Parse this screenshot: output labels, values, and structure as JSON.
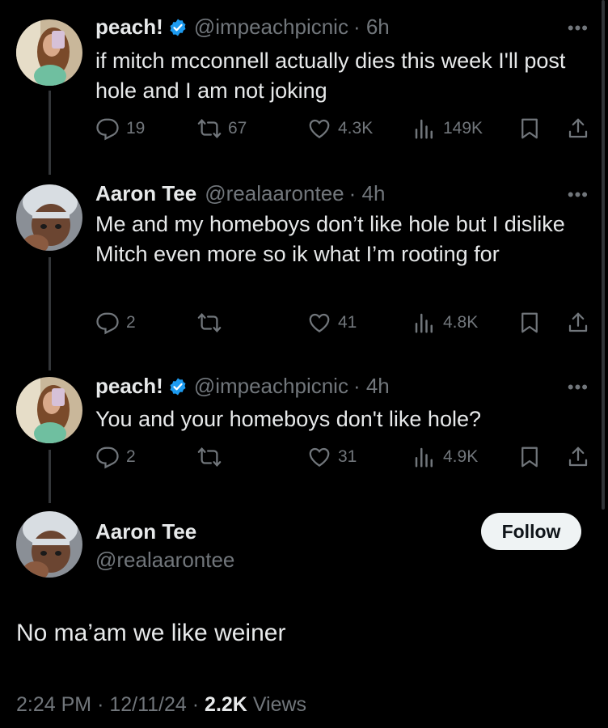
{
  "tweets": [
    {
      "name": "peach!",
      "handle": "@impeachpicnic",
      "time": "· 6h",
      "text": "if mitch mcconnell actually dies this week I'll post hole and I am not joking",
      "replies": "19",
      "retweets": "67",
      "likes": "4.3K",
      "views": "149K"
    },
    {
      "name": "Aaron Tee",
      "handle": "@realaarontee",
      "time": "· 4h",
      "text": "Me and my homeboys don’t like hole but I dislike Mitch even more so ik what I’m rooting for",
      "replies": "2",
      "retweets": "",
      "likes": "41",
      "views": "4.8K"
    },
    {
      "name": "peach!",
      "handle": "@impeachpicnic",
      "time": "· 4h",
      "text": "You and your homeboys don't like hole?",
      "replies": "2",
      "retweets": "",
      "likes": "31",
      "views": "4.9K"
    }
  ],
  "main": {
    "name": "Aaron Tee",
    "handle": "@realaarontee",
    "follow_label": "Follow",
    "text": "No ma’am we like weiner",
    "time": "2:24 PM",
    "date": "12/11/24",
    "views_count": "2.2K",
    "views_label": "Views"
  },
  "icons": {
    "more": "more-icon",
    "reply": "reply-icon",
    "retweet": "retweet-icon",
    "like": "heart-icon",
    "views": "analytics-icon",
    "bookmark": "bookmark-icon",
    "share": "share-icon",
    "verified": "verified-badge-icon"
  },
  "colors": {
    "background": "#000000",
    "text": "#e7e9ea",
    "secondary": "#71767b",
    "verified": "#1d9bf0",
    "follow_bg": "#eff3f4"
  }
}
